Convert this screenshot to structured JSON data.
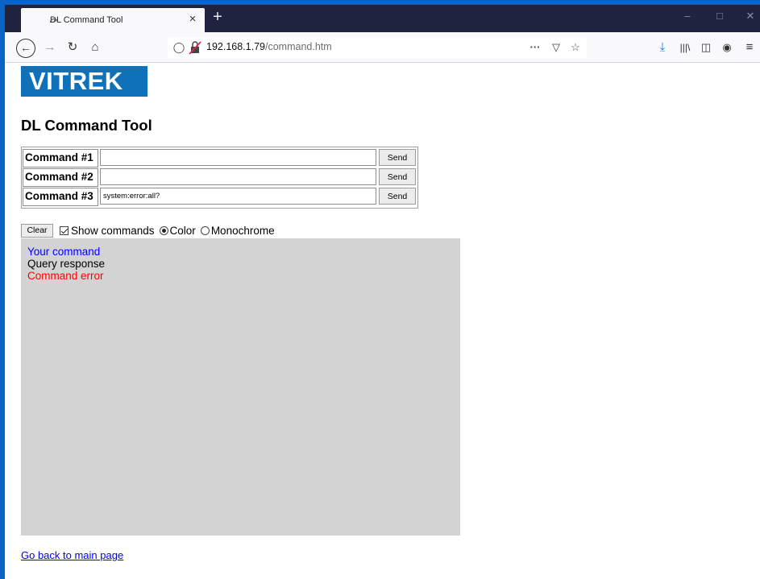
{
  "browser": {
    "tab_title": "DL Command Tool",
    "tab_close": "×",
    "new_tab": "+",
    "url_host": "192.168.1.79",
    "url_path": "/command.htm",
    "page_actions": "···"
  },
  "page": {
    "logo_text": "VITREK",
    "title": "DL Command Tool",
    "commands": [
      {
        "label": "Command #1",
        "value": "",
        "send_label": "Send"
      },
      {
        "label": "Command #2",
        "value": "",
        "send_label": "Send"
      },
      {
        "label": "Command #3",
        "value": "system:error:all?",
        "send_label": "Send"
      }
    ],
    "controls": {
      "clear_label": "Clear",
      "show_commands_label": "Show commands",
      "show_commands_checked": true,
      "color_label": "Color",
      "monochrome_label": "Monochrome",
      "selected_mode": "Color"
    },
    "output_legend": [
      {
        "text": "Your command",
        "color": "#0000ff"
      },
      {
        "text": "Query response",
        "color": "#000000"
      },
      {
        "text": "Command error",
        "color": "#ff0000"
      }
    ],
    "back_link": "Go back to main page"
  },
  "colors": {
    "accent": "#0e71b9",
    "output_bg": "#d3d3d3",
    "window_frame": "#0a64c8",
    "tabbar_bg": "#202340"
  }
}
